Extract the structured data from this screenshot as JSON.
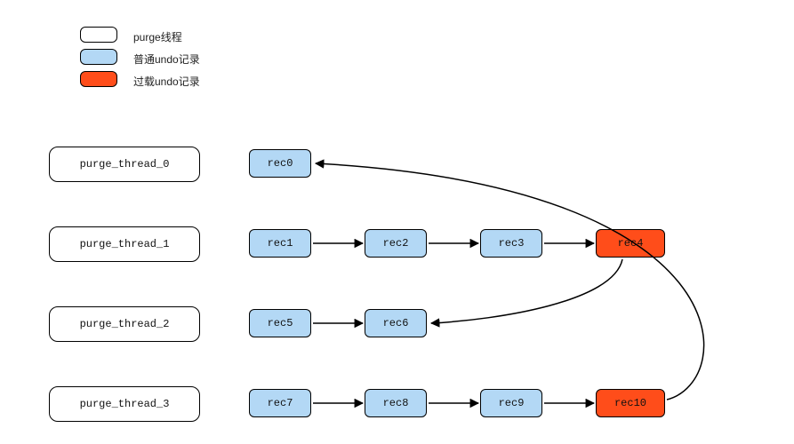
{
  "legend": {
    "thread_label": "purge线程",
    "normal_label": "普通undo记录",
    "overload_label": "过载undo记录"
  },
  "threads": [
    {
      "name": "purge_thread_0",
      "records": [
        {
          "label": "rec0",
          "type": "normal"
        }
      ]
    },
    {
      "name": "purge_thread_1",
      "records": [
        {
          "label": "rec1",
          "type": "normal"
        },
        {
          "label": "rec2",
          "type": "normal"
        },
        {
          "label": "rec3",
          "type": "normal"
        },
        {
          "label": "rec4",
          "type": "overload"
        }
      ]
    },
    {
      "name": "purge_thread_2",
      "records": [
        {
          "label": "rec5",
          "type": "normal"
        },
        {
          "label": "rec6",
          "type": "normal"
        }
      ]
    },
    {
      "name": "purge_thread_3",
      "records": [
        {
          "label": "rec7",
          "type": "normal"
        },
        {
          "label": "rec8",
          "type": "normal"
        },
        {
          "label": "rec9",
          "type": "normal"
        },
        {
          "label": "rec10",
          "type": "overload"
        }
      ]
    }
  ],
  "overflow_edges": [
    {
      "from": "rec4",
      "to_thread": 2,
      "after": "rec6"
    },
    {
      "from": "rec10",
      "to_thread": 0,
      "after": "rec0"
    }
  ],
  "colors": {
    "normal": "#b3d8f5",
    "overload": "#ff4d1a",
    "border": "#000000"
  }
}
